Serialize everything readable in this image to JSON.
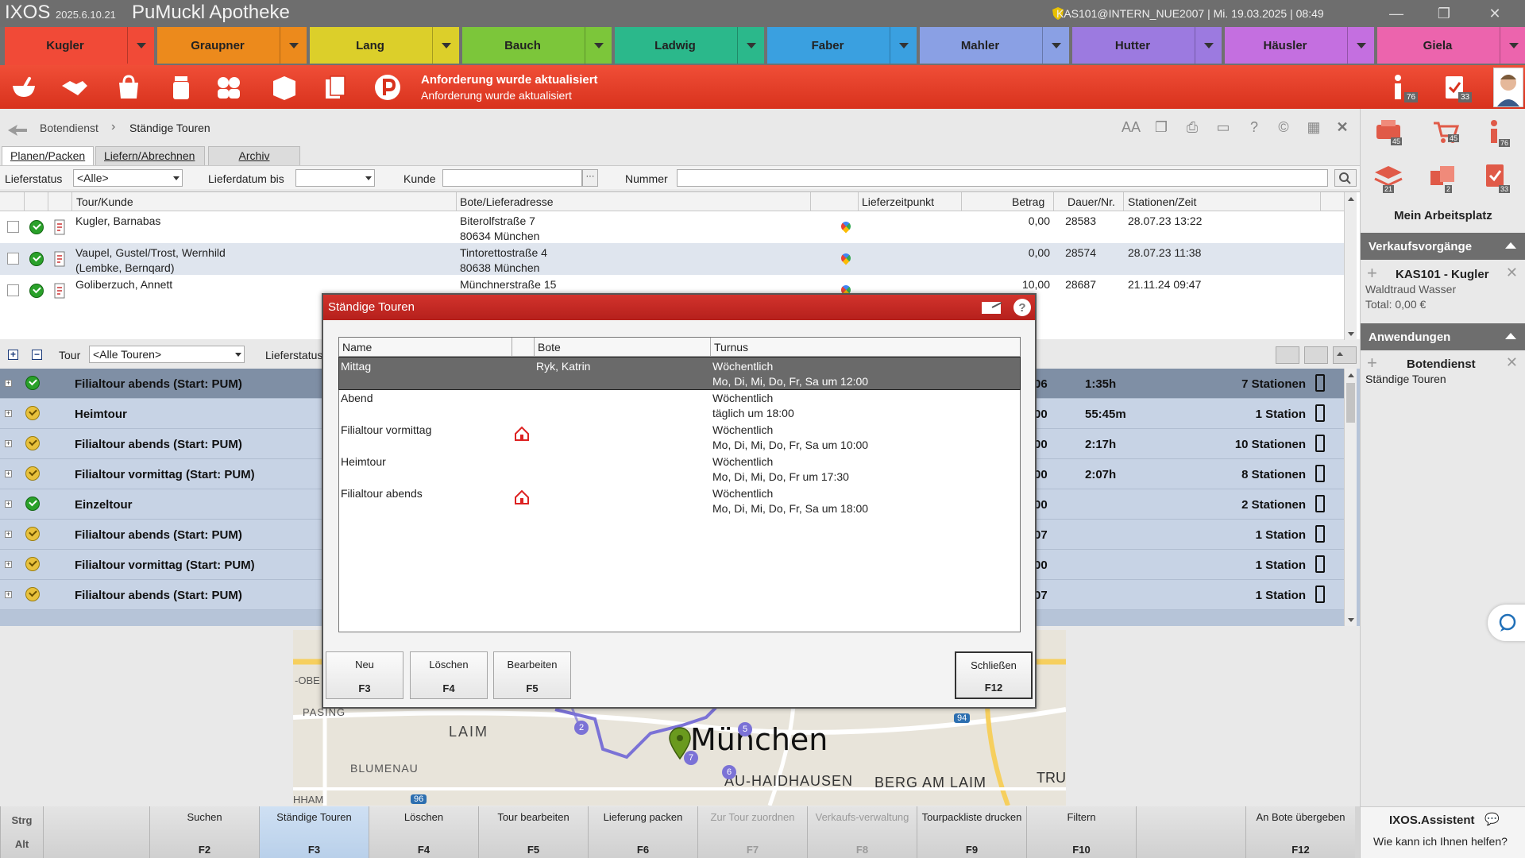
{
  "titlebar": {
    "app": "IXOS",
    "version": "2025.6.10.21",
    "pharmacy": "PuMuckl Apotheke",
    "session": "KAS101@INTERN_NUE2007 | Mi. 19.03.2025 | 08:49"
  },
  "user_tabs": [
    {
      "name": "Kugler",
      "color": "#f14a37"
    },
    {
      "name": "Graupner",
      "color": "#ec8a1c"
    },
    {
      "name": "Lang",
      "color": "#dccf2a"
    },
    {
      "name": "Bauch",
      "color": "#7cc63a"
    },
    {
      "name": "Ladwig",
      "color": "#2bb88b"
    },
    {
      "name": "Faber",
      "color": "#3aa0e0"
    },
    {
      "name": "Mahler",
      "color": "#8aa0e4"
    },
    {
      "name": "Hutter",
      "color": "#9c7ae0"
    },
    {
      "name": "Häusler",
      "color": "#c46fe0"
    },
    {
      "name": "Giela",
      "color": "#ec64ad"
    }
  ],
  "toolbar": {
    "message_title": "Anforderung wurde aktualisiert",
    "message_sub": "Anforderung wurde aktualisiert",
    "info_badge": "76",
    "tasks_badge": "33"
  },
  "breadcrumb": {
    "root": "Botendienst",
    "separator": "›",
    "current": "Ständige Touren"
  },
  "subtabs": [
    "Planen/Packen",
    "Liefern/Abrechnen",
    "Archiv"
  ],
  "filters": {
    "status_label": "Lieferstatus",
    "status_value": "<Alle>",
    "date_label": "Lieferdatum bis",
    "customer_label": "Kunde",
    "number_label": "Nummer"
  },
  "orders": {
    "headers": [
      "Tour/Kunde",
      "Bote/Lieferadresse",
      "Lieferzeitpunkt",
      "Betrag",
      "Dauer/Nr.",
      "Stationen/Zeit"
    ],
    "rows": [
      {
        "customer": "Kugler, Barnabas",
        "customer2": "",
        "street": "Biterolfstraße 7",
        "city": "80634 München",
        "amount": "0,00",
        "nr": "28583",
        "time": "28.07.23 13:22"
      },
      {
        "customer": "Vaupel, Gustel/Trost, Wernhild",
        "customer2": "(Lembke, Bernqard)",
        "street": "Tintorettostraße 4",
        "city": "80638 München",
        "amount": "0,00",
        "nr": "28574",
        "time": "28.07.23 11:38"
      },
      {
        "customer": "Goliberzuch, Annett",
        "customer2": "",
        "street": "Münchnerstraße 15",
        "city": "",
        "amount": "10,00",
        "nr": "28687",
        "time": "21.11.24 09:47"
      }
    ]
  },
  "tourbar": {
    "tour_label": "Tour",
    "tour_value": "<Alle Touren>",
    "status_label": "Lieferstatus"
  },
  "tours": [
    {
      "name": "Filialtour abends (Start: PUM)",
      "status": "ok",
      "mid": "06",
      "duration": "1:35h",
      "stations": "7 Stationen"
    },
    {
      "name": "Heimtour",
      "status": "warn",
      "mid": "00",
      "duration": "55:45m",
      "stations": "1 Station"
    },
    {
      "name": "Filialtour abends (Start: PUM)",
      "status": "warn",
      "mid": "00",
      "duration": "2:17h",
      "stations": "10 Stationen"
    },
    {
      "name": "Filialtour vormittag (Start: PUM)",
      "status": "warn",
      "mid": "00",
      "duration": "2:07h",
      "stations": "8 Stationen"
    },
    {
      "name": "Einzeltour",
      "status": "ok",
      "mid": "00",
      "duration": "",
      "stations": "2 Stationen"
    },
    {
      "name": "Filialtour abends (Start: PUM)",
      "status": "warn",
      "mid": "07",
      "duration": "",
      "stations": "1 Station"
    },
    {
      "name": "Filialtour vormittag (Start: PUM)",
      "status": "warn",
      "mid": "00",
      "duration": "",
      "stations": "1 Station"
    },
    {
      "name": "Filialtour abends (Start: PUM)",
      "status": "warn",
      "mid": "07",
      "duration": "",
      "stations": "1 Station"
    }
  ],
  "map": {
    "city": "München",
    "labels": [
      "LAIM",
      "PASING",
      "BLUMENAU",
      "AU-HAIDHAUSEN",
      "BERG AM LAIM",
      "TRU",
      "HHAM",
      "-OBE"
    ],
    "road_numbers": [
      "94",
      "96"
    ],
    "stops": [
      "2",
      "5",
      "6",
      "7"
    ]
  },
  "fkeys": [
    {
      "label": "Strg",
      "key": "Alt"
    },
    {
      "label": "",
      "key": ""
    },
    {
      "label": "Suchen",
      "key": "F2"
    },
    {
      "label": "Ständige Touren",
      "key": "F3"
    },
    {
      "label": "Löschen",
      "key": "F4"
    },
    {
      "label": "Tour bearbeiten",
      "key": "F5"
    },
    {
      "label": "Lieferung packen",
      "key": "F6"
    },
    {
      "label": "Zur Tour zuordnen",
      "key": "F7"
    },
    {
      "label": "Verkaufs-verwaltung",
      "key": "F8"
    },
    {
      "label": "Tourpackliste drucken",
      "key": "F9"
    },
    {
      "label": "Filtern",
      "key": "F10"
    },
    {
      "label": "",
      "key": ""
    },
    {
      "label": "An Bote übergeben",
      "key": "F12"
    }
  ],
  "sidebar": {
    "workplace_title": "Mein Arbeitsplatz",
    "badges": [
      "45",
      "45",
      "76",
      "21",
      "2",
      "33"
    ],
    "sales_section": "Verkaufsvorgänge",
    "sale_title": "KAS101 - Kugler",
    "sale_customer": "Waldtraud Wasser",
    "sale_total": "Total: 0,00 €",
    "apps_section": "Anwendungen",
    "app_title": "Botendienst",
    "app_sub": "Ständige Touren",
    "assistant_title": "IXOS.Assistent",
    "assistant_sub": "Wie kann ich Ihnen helfen?"
  },
  "dialog": {
    "title": "Ständige Touren",
    "headers": [
      "Name",
      "",
      "Bote",
      "Turnus"
    ],
    "rows": [
      {
        "name": "Mittag",
        "bote": "Ryk, Katrin",
        "turnus1": "Wöchentlich",
        "turnus2": "Mo, Di, Mi, Do, Fr, Sa um 12:00"
      },
      {
        "name": "Abend",
        "bote": "",
        "turnus1": "Wöchentlich",
        "turnus2": "täglich um 18:00"
      },
      {
        "name": "Filialtour vormittag",
        "bote": "",
        "turnus1": "Wöchentlich",
        "turnus2": "Mo, Di, Mi, Do, Fr, Sa um 10:00"
      },
      {
        "name": "Heimtour",
        "bote": "",
        "turnus1": "Wöchentlich",
        "turnus2": "Mo, Di, Mi, Do, Fr um 17:30"
      },
      {
        "name": "Filialtour abends",
        "bote": "",
        "turnus1": "Wöchentlich",
        "turnus2": "Mo, Di, Mi, Do, Fr, Sa um 18:00"
      }
    ],
    "buttons": [
      {
        "label": "Neu",
        "key": "F3"
      },
      {
        "label": "Löschen",
        "key": "F4"
      },
      {
        "label": "Bearbeiten",
        "key": "F5"
      },
      {
        "label": "Schließen",
        "key": "F12"
      }
    ]
  }
}
